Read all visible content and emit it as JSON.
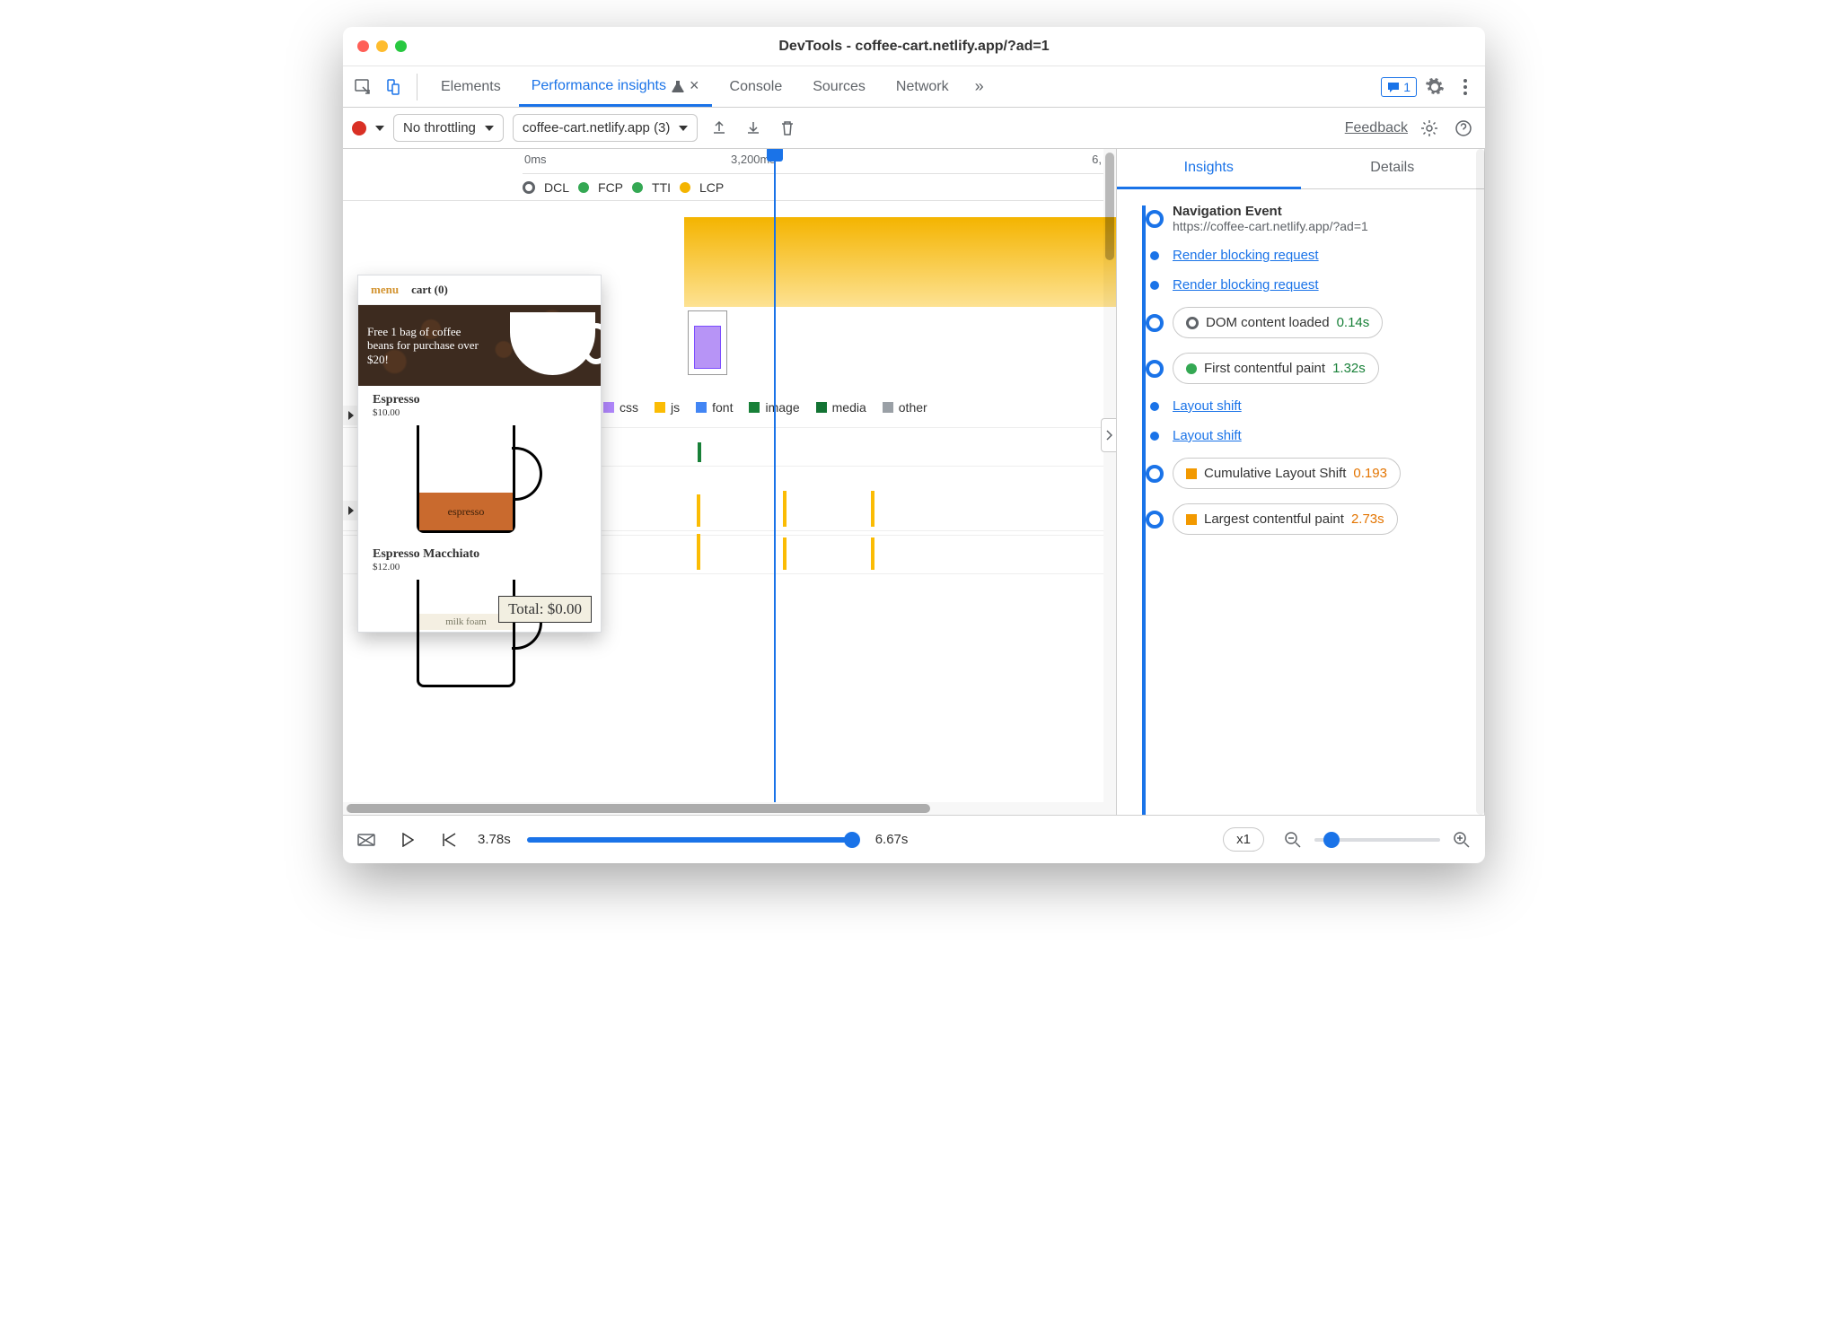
{
  "window_title": "DevTools - coffee-cart.netlify.app/?ad=1",
  "tabs": {
    "elements": "Elements",
    "perf": "Performance insights",
    "console": "Console",
    "sources": "Sources",
    "network": "Network"
  },
  "msg_count": "1",
  "toolbar": {
    "throttle": "No throttling",
    "recording": "coffee-cart.netlify.app (3)",
    "feedback": "Feedback"
  },
  "ruler": {
    "t0": "0ms",
    "t1": "3,200ms",
    "t2": "6,"
  },
  "markers": {
    "dcl": "DCL",
    "fcp": "FCP",
    "tti": "TTI",
    "lcp": "LCP"
  },
  "legend": {
    "css": "css",
    "js": "js",
    "font": "font",
    "image": "image",
    "media": "media",
    "other": "other"
  },
  "preview": {
    "menu": "menu",
    "cart": "cart (0)",
    "banner": "Free 1 bag of coffee beans for purchase over $20!",
    "p1_name": "Espresso",
    "p1_price": "$10.00",
    "p1_fill": "espresso",
    "p2_name": "Espresso Macchiato",
    "p2_price": "$12.00",
    "p2_fill": "milk foam",
    "total": "Total: $0.00"
  },
  "right": {
    "tab_insights": "Insights",
    "tab_details": "Details",
    "nav_title": "Navigation Event",
    "nav_url": "https://coffee-cart.netlify.app/?ad=1",
    "rb1": "Render blocking request",
    "rb2": "Render blocking request",
    "dcl_label": "DOM content loaded",
    "dcl_val": "0.14s",
    "fcp_label": "First contentful paint",
    "fcp_val": "1.32s",
    "ls1": "Layout shift",
    "ls2": "Layout shift",
    "cls_label": "Cumulative Layout Shift",
    "cls_val": "0.193",
    "lcp_label": "Largest contentful paint",
    "lcp_val": "2.73s"
  },
  "footer": {
    "cur_time": "3.78s",
    "end_time": "6.67s",
    "speed": "x1"
  }
}
